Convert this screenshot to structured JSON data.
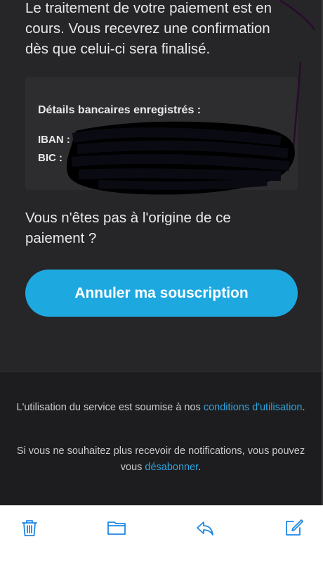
{
  "email": {
    "intro_text": "Le traitement de votre paiement est en cours. Vous recevrez une confirmation dès que celui-ci sera finalisé.",
    "bank_details": {
      "title": "Détails bancaires enregistrés :",
      "iban_label": "IBAN :",
      "bic_label": "BIC :"
    },
    "question_text": "Vous n'êtes pas à l'origine de ce paiement ?",
    "cancel_button_label": "Annuler ma souscription"
  },
  "footer": {
    "terms_text": "L'utilisation du service est soumise à nos ",
    "terms_link": "conditions d'utilisation",
    "terms_end": ".",
    "unsub_text": "Si vous ne souhaitez plus recevoir de notifications, vous pouvez vous ",
    "unsub_link": "désabonner",
    "unsub_end": "."
  },
  "toolbar": {
    "icons": [
      "trash-icon",
      "folder-icon",
      "reply-icon",
      "compose-icon"
    ]
  },
  "colors": {
    "accent": "#1ea8e0",
    "email_background": "#262628",
    "footer_background": "#1d1d1f",
    "link": "#2fa4df",
    "toolbar_icon": "#1e88e5",
    "scribble": "#2a0a2e"
  }
}
